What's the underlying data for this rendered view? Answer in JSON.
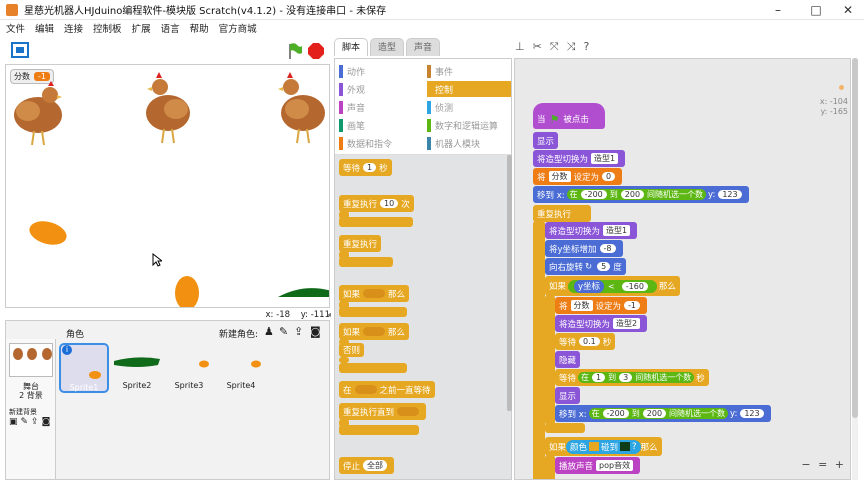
{
  "window": {
    "title": "星慈光机器人HJduino编程软件-模块版 Scratch(v4.1.2) - 没有连接串口 - 未保存",
    "controls": [
      "–",
      "□",
      "✕"
    ]
  },
  "menu": [
    "文件",
    "编辑",
    "连接",
    "控制板",
    "扩展",
    "语言",
    "帮助",
    "官方商城"
  ],
  "stage": {
    "score_label": "分数",
    "score_value": "-1",
    "mouse_x": "x: -18",
    "mouse_y": "y: -111"
  },
  "sprites_panel": {
    "roles_label": "角色",
    "new_sprite_label": "新建角色:",
    "stage_label": "舞台",
    "backdrop_count": "2 背景",
    "new_backdrop_label": "新建背景",
    "sprites": [
      "Sprite1",
      "Sprite2",
      "Sprite3",
      "Sprite4"
    ]
  },
  "tabs": [
    "脚本",
    "造型",
    "声音"
  ],
  "categories": [
    {
      "label": "动作",
      "color": "#4a6cd4"
    },
    {
      "label": "事件",
      "color": "#c88330"
    },
    {
      "label": "外观",
      "color": "#8a55d7"
    },
    {
      "label": "控制",
      "color": "#e6a822"
    },
    {
      "label": "声音",
      "color": "#bb42c3"
    },
    {
      "label": "侦测",
      "color": "#2ca5e2"
    },
    {
      "label": "画笔",
      "color": "#0e9a6c"
    },
    {
      "label": "数字和逻辑运算",
      "color": "#5cb712"
    },
    {
      "label": "数据和指令",
      "color": "#ee7d16"
    },
    {
      "label": "机器人模块",
      "color": "#3b86a8"
    }
  ],
  "palette_blocks": {
    "wait": "等待",
    "wait_val": "1",
    "wait_unit": "秒",
    "repeat": "重复执行",
    "repeat_val": "10",
    "repeat_unit": "次",
    "forever": "重复执行",
    "if1": "如果",
    "then1": "那么",
    "if2": "如果",
    "then2": "那么",
    "else": "否则",
    "wait_until_pre": "在",
    "wait_until_post": "之前一直等待",
    "repeat_until": "重复执行直到",
    "stop": "停止",
    "stop_opt": "全部"
  },
  "script": {
    "hat": "当",
    "hat_post": "被点击",
    "show1": "显示",
    "switch1": "将造型切换为",
    "switch1_val": "造型1",
    "set": "将",
    "set_var": "分数",
    "set_mid": "设定为",
    "set_val": "0",
    "goto": "移到 x:",
    "goto_in": "在",
    "goto_a": "-200",
    "goto_to": "到",
    "goto_b": "200",
    "goto_rand": "间随机选一个数",
    "goto_y": "y:",
    "goto_yv": "123",
    "forever": "重复执行",
    "switch2": "将造型切换为",
    "switch2_val": "造型1",
    "changey": "将y坐标增加",
    "changey_val": "-8",
    "turn": "向右旋转",
    "turn_val": "5",
    "turn_unit": "度",
    "if": "如果",
    "if_cond": "y坐标",
    "if_lt": "<",
    "if_val": "-160",
    "then": "那么",
    "set2": "将",
    "set2_var": "分数",
    "set2_mid": "设定为",
    "set2_val": "-1",
    "switch3": "将造型切换为",
    "switch3_val": "造型2",
    "wait1": "等待",
    "wait1_val": "0.1",
    "wait1_unit": "秒",
    "hide": "隐藏",
    "wait2": "等待",
    "wait2_in": "在",
    "wait2_a": "1",
    "wait2_to": "到",
    "wait2_b": "3",
    "wait2_rand": "间随机选一个数",
    "wait2_unit": "秒",
    "show2": "显示",
    "goto2": "移到 x:",
    "goto2_in": "在",
    "goto2_a": "-200",
    "goto2_to": "到",
    "goto2_b": "200",
    "goto2_rand": "间随机选一个数",
    "goto2_y": "y:",
    "goto2_yv": "123",
    "if2": "如果",
    "if2_color": "颜色",
    "if2_touch": "碰到",
    "if2_q": "?",
    "if2_then": "那么",
    "play": "播放声音",
    "play_val": "pop音效"
  },
  "script_xy": {
    "x": "x: -104",
    "y": "y: -165"
  },
  "zoom": [
    "−",
    "=",
    "+"
  ]
}
